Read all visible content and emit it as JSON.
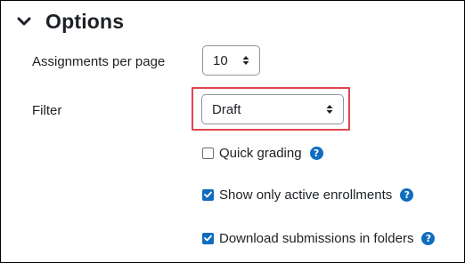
{
  "section": {
    "title": "Options",
    "toggle_icon": "chevron-down-icon"
  },
  "assignments_per_page": {
    "label": "Assignments per page",
    "value": "10"
  },
  "filter": {
    "label": "Filter",
    "value": "Draft",
    "highlight_color": "#e0454c"
  },
  "checkboxes": [
    {
      "label": "Quick grading",
      "checked": false,
      "help_icon": "question-circle-icon"
    },
    {
      "label": "Show only active enrollments",
      "checked": true,
      "help_icon": "question-circle-icon"
    },
    {
      "label": "Download submissions in folders",
      "checked": true,
      "help_icon": "question-circle-icon"
    }
  ],
  "help_glyph": "?",
  "colors": {
    "accent": "#0f6cbf",
    "text": "#1d2125",
    "highlight": "#e0454c"
  }
}
